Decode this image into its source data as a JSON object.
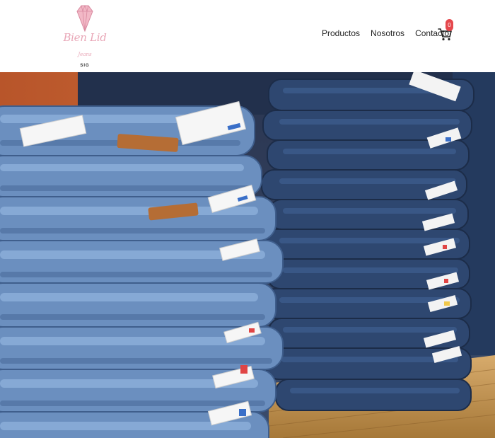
{
  "header": {
    "logo": {
      "script_text": "Bien Lid",
      "sub_text": "Jeans",
      "tag_text": "SIG",
      "accent_color": "#e9a8b8"
    },
    "nav": [
      {
        "label": "Productos"
      },
      {
        "label": "Nosotros"
      },
      {
        "label": "Contacto"
      }
    ],
    "cart": {
      "icon": "shopping-cart-icon",
      "count": "0",
      "badge_color": "#e5484d"
    }
  },
  "hero": {
    "image": "stacked-denim-jeans-photo",
    "colors": {
      "denim_light": "#7fa3cf",
      "denim_mid": "#5277a8",
      "denim_dark": "#2e4770",
      "shelf_wood": "#c89a5c",
      "wall_orange": "#c8632f"
    }
  }
}
